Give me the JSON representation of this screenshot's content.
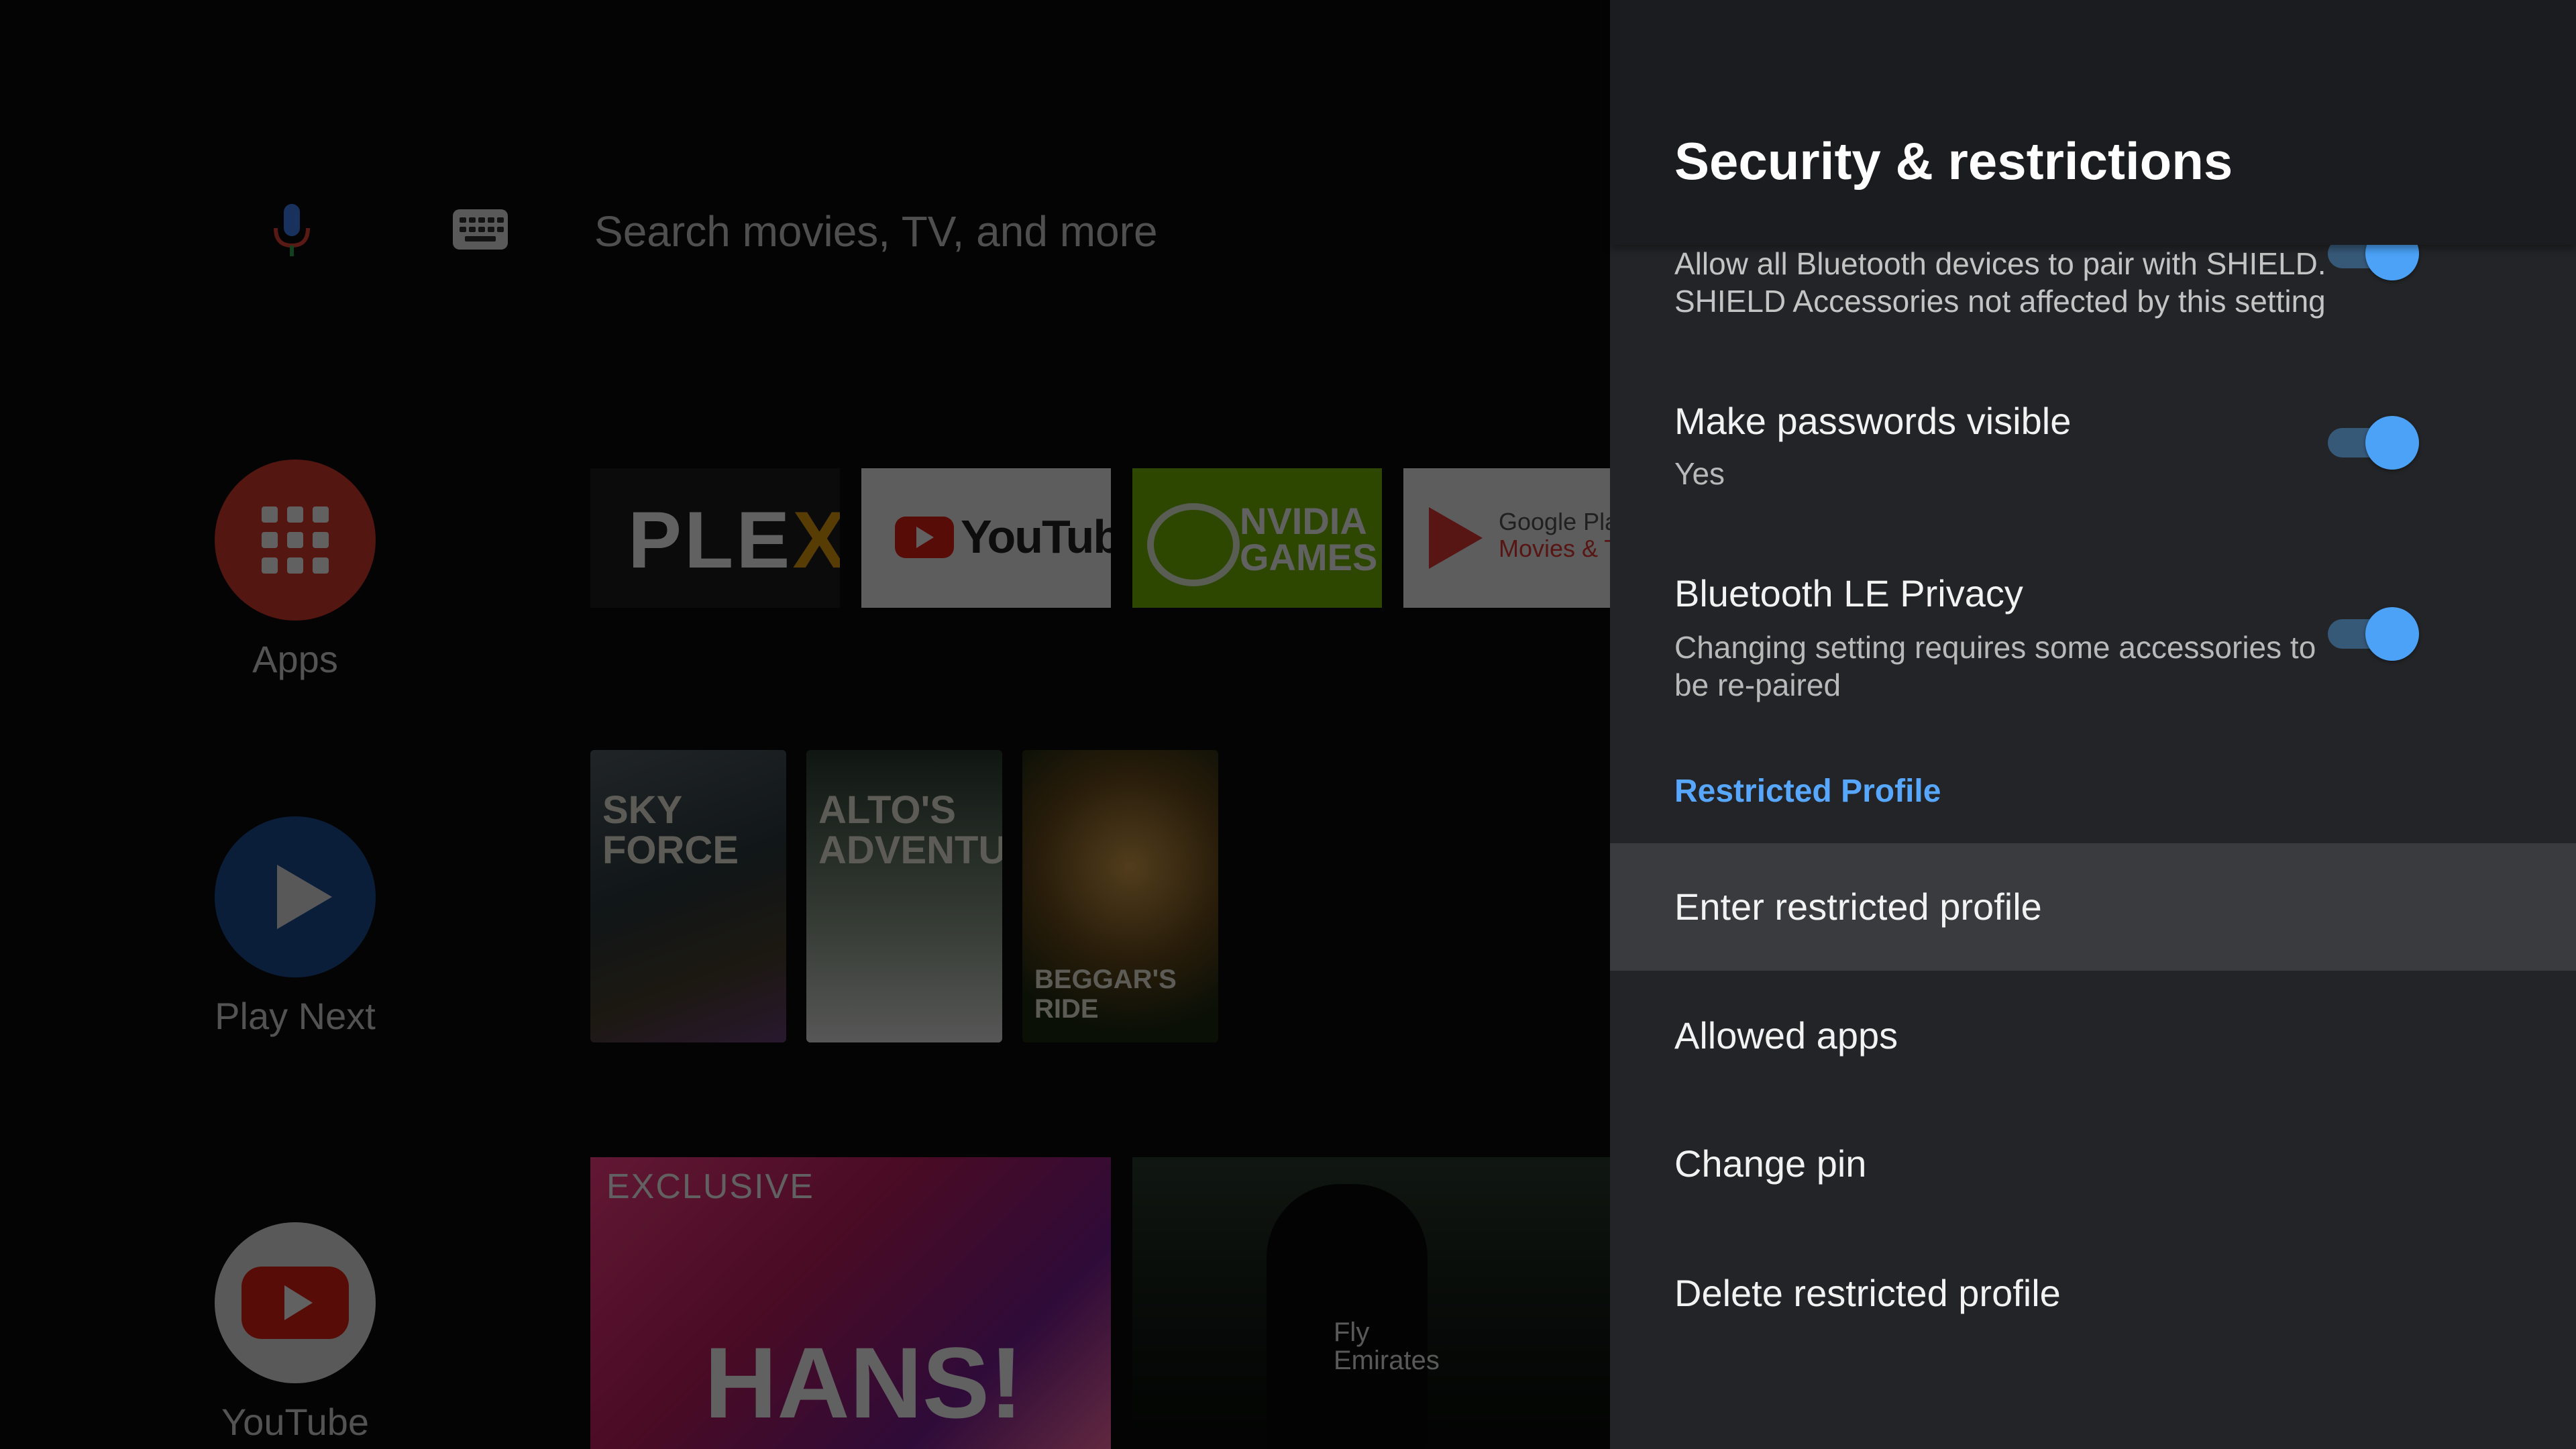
{
  "home": {
    "search_placeholder": "Search movies, TV, and more",
    "rail": {
      "apps_label": "Apps",
      "play_next_label": "Play Next",
      "youtube_label": "YouTube"
    },
    "tiles": {
      "plex": "PLEX",
      "youtube": "YouTube",
      "nvidia_line1": "NVIDIA",
      "nvidia_line2": "GAMES",
      "google_play_line1": "Google Play",
      "google_play_line2": "Movies & TV"
    },
    "posters": {
      "sky_force": "SKY FORCE",
      "alto": "ALTO'S ADVENTURE",
      "beggar": "BEGGAR'S RIDE"
    },
    "cards": {
      "exclusive": "EXCLUSIVE",
      "hans": "HANS!",
      "jersey_line1": "Fly",
      "jersey_line2": "Emirates"
    }
  },
  "panel": {
    "title": "Security & restrictions",
    "bluetooth_pairing": {
      "line1": "Allow all Bluetooth devices to pair with SHIELD.",
      "line2": "SHIELD Accessories not affected by this setting",
      "enabled": true
    },
    "passwords": {
      "title": "Make passwords visible",
      "subtitle": "Yes",
      "enabled": true
    },
    "ble_privacy": {
      "title": "Bluetooth LE Privacy",
      "subtitle_line1": "Changing setting requires some accessories to",
      "subtitle_line2": "be re-paired",
      "enabled": true
    },
    "section_label": "Restricted Profile",
    "items": [
      {
        "label": "Enter restricted profile",
        "focused": true
      },
      {
        "label": "Allowed apps",
        "focused": false
      },
      {
        "label": "Change pin",
        "focused": false
      },
      {
        "label": "Delete restricted profile",
        "focused": false
      }
    ]
  },
  "colors": {
    "accent": "#4ba2f7",
    "section": "#57a7ff",
    "panel_bg": "#232427",
    "focus_bg": "#3a3b3f"
  }
}
